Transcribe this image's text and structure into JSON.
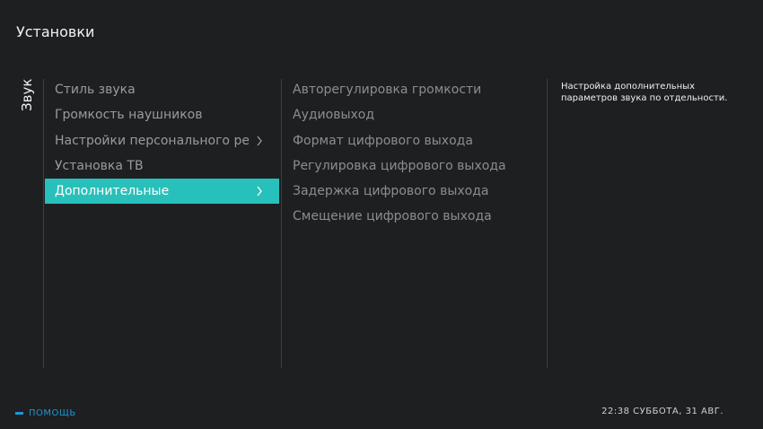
{
  "header": {
    "title": "Установки"
  },
  "section": {
    "label": "Звук"
  },
  "left_menu": {
    "items": [
      {
        "label": "Стиль звука",
        "has_submenu": false,
        "selected": false
      },
      {
        "label": "Громкость наушников",
        "has_submenu": false,
        "selected": false
      },
      {
        "label": "Настройки персонального режима",
        "has_submenu": true,
        "selected": false
      },
      {
        "label": "Установка ТВ",
        "has_submenu": false,
        "selected": false
      },
      {
        "label": "Дополнительные",
        "has_submenu": true,
        "selected": true
      }
    ]
  },
  "right_menu": {
    "items": [
      {
        "label": "Авторегулировка громкости"
      },
      {
        "label": "Аудиовыход"
      },
      {
        "label": "Формат цифрового выхода"
      },
      {
        "label": "Регулировка цифрового выхода"
      },
      {
        "label": "Задержка цифрового выхода"
      },
      {
        "label": "Смещение цифрового выхода"
      }
    ]
  },
  "description": {
    "text": "Настройка дополнительных параметров звука по отдельности."
  },
  "footer": {
    "help_label": "ПОМОЩЬ",
    "datetime": "22:38 СУББОТА, 31 АВГ."
  },
  "colors": {
    "background": "#1e1f21",
    "selection": "#28c0bb",
    "help_accent": "#1d98d8",
    "divider": "#3d3e41"
  },
  "icons": {
    "submenu": "chevron-right-icon",
    "help": "dash-icon"
  }
}
